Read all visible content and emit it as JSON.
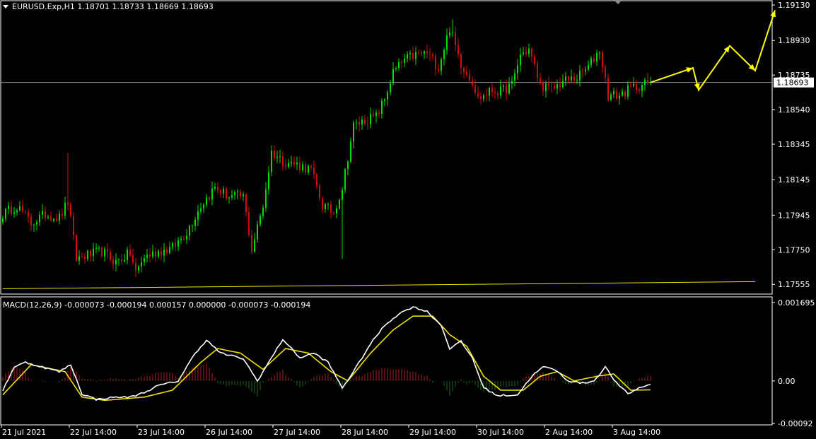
{
  "header": {
    "symbol": "EURUSD.Exp,H1",
    "open": "1.18701",
    "high": "1.18733",
    "low": "1.18669",
    "close": "1.18693"
  },
  "macd_header": {
    "name": "MACD(12,26,9)",
    "values": "-0.000073 -0.000194 0.000157 0.000000 -0.000073 -0.000194"
  },
  "colors": {
    "background": "#000000",
    "bull_candle": "#00e000",
    "bear_candle": "#d01010",
    "trendline": "#f0e000",
    "arrow": "#ffff00",
    "macd_main": "#ffffff",
    "macd_signal": "#f0e000",
    "hist_positive": "#b02020",
    "hist_negative": "#1e6a1e",
    "grid_frame": "#ffffff",
    "price_line": "#8c8c8c"
  },
  "chart_data": [
    {
      "type": "candlestick",
      "title": "EURUSD.Exp,H1",
      "current_price": 1.18693,
      "current_price_label": "1.18693",
      "ylim": [
        1.175,
        1.1915
      ],
      "y_tick_labels": [
        "1.19130",
        "1.18930",
        "1.18735",
        "1.18540",
        "1.18345",
        "1.18145",
        "1.17945",
        "1.17750",
        "1.17555"
      ],
      "y_tick_values": [
        1.1913,
        1.1893,
        1.18735,
        1.1854,
        1.18345,
        1.18145,
        1.17945,
        1.1775,
        1.17555
      ],
      "x_tick_labels": [
        "21 Jul 2021",
        "22 Jul 14:00",
        "23 Jul 14:00",
        "26 Jul 14:00",
        "27 Jul 14:00",
        "28 Jul 14:00",
        "29 Jul 14:00",
        "30 Jul 14:00",
        "2 Aug 14:00",
        "3 Aug 14:00"
      ],
      "x_tick_bars": [
        0,
        24,
        48,
        72,
        96,
        120,
        144,
        168,
        192,
        216
      ],
      "bar_count": 230,
      "anchors": [
        [
          0,
          1.1795
        ],
        [
          5,
          1.18
        ],
        [
          10,
          1.179
        ],
        [
          15,
          1.1795
        ],
        [
          20,
          1.1793
        ],
        [
          23,
          1.1802
        ],
        [
          26,
          1.177
        ],
        [
          30,
          1.1772
        ],
        [
          35,
          1.1774
        ],
        [
          40,
          1.1768
        ],
        [
          45,
          1.1773
        ],
        [
          47,
          1.1762
        ],
        [
          50,
          1.1771
        ],
        [
          55,
          1.1774
        ],
        [
          60,
          1.1776
        ],
        [
          65,
          1.1785
        ],
        [
          70,
          1.18
        ],
        [
          75,
          1.181
        ],
        [
          80,
          1.1805
        ],
        [
          85,
          1.1805
        ],
        [
          88,
          1.1775
        ],
        [
          92,
          1.18
        ],
        [
          95,
          1.183
        ],
        [
          99,
          1.1825
        ],
        [
          104,
          1.1823
        ],
        [
          109,
          1.182
        ],
        [
          113,
          1.18
        ],
        [
          117,
          1.1796
        ],
        [
          120,
          1.181
        ],
        [
          124,
          1.1845
        ],
        [
          128,
          1.1848
        ],
        [
          132,
          1.185
        ],
        [
          135,
          1.186
        ],
        [
          138,
          1.1875
        ],
        [
          142,
          1.1882
        ],
        [
          146,
          1.1885
        ],
        [
          150,
          1.1886
        ],
        [
          154,
          1.1878
        ],
        [
          158,
          1.19
        ],
        [
          162,
          1.188
        ],
        [
          166,
          1.187
        ],
        [
          168,
          1.186
        ],
        [
          170,
          1.1862
        ],
        [
          173,
          1.1865
        ],
        [
          176,
          1.1864
        ],
        [
          180,
          1.1868
        ],
        [
          183,
          1.1885
        ],
        [
          186,
          1.1888
        ],
        [
          190,
          1.1868
        ],
        [
          194,
          1.1865
        ],
        [
          198,
          1.187
        ],
        [
          203,
          1.1872
        ],
        [
          207,
          1.1878
        ],
        [
          211,
          1.1888
        ],
        [
          214,
          1.1862
        ],
        [
          218,
          1.1862
        ],
        [
          222,
          1.1866
        ],
        [
          226,
          1.1868
        ],
        [
          229,
          1.18693
        ]
      ],
      "spikes": [
        {
          "bar": 23,
          "high": 1.183
        },
        {
          "bar": 120,
          "low": 1.177
        },
        {
          "bar": 159,
          "high": 1.1905
        }
      ],
      "trendline": {
        "start": [
          0,
          1.1753
        ],
        "end": [
          266,
          1.1757
        ]
      },
      "forecast_path": [
        [
          229,
          1.18693
        ],
        [
          244,
          1.18775
        ],
        [
          246,
          1.1865
        ],
        [
          257,
          1.189
        ],
        [
          266,
          1.1876
        ],
        [
          273,
          1.191
        ]
      ],
      "forecast_arrowheads": [
        1,
        2,
        3,
        4,
        5
      ]
    },
    {
      "type": "macd",
      "title": "MACD(12,26,9)",
      "ylim": [
        -0.00095,
        0.0018
      ],
      "y_tick_labels": [
        "0.001695",
        "0.00",
        "-0.00092"
      ],
      "y_tick_values": [
        0.001695,
        0.0,
        -0.00092
      ],
      "main_anchors": [
        [
          0,
          -0.0002
        ],
        [
          4,
          0.0003
        ],
        [
          8,
          0.0004
        ],
        [
          14,
          0.0003
        ],
        [
          20,
          0.0002
        ],
        [
          24,
          0.00035
        ],
        [
          28,
          -0.00028
        ],
        [
          33,
          -0.0004
        ],
        [
          40,
          -0.00035
        ],
        [
          45,
          -0.00035
        ],
        [
          50,
          -0.00025
        ],
        [
          55,
          -0.0001
        ],
        [
          62,
          0.0
        ],
        [
          68,
          0.0006
        ],
        [
          72,
          0.00088
        ],
        [
          77,
          0.0006
        ],
        [
          85,
          0.00048
        ],
        [
          90,
          0.0
        ],
        [
          95,
          0.0005
        ],
        [
          99,
          0.0009
        ],
        [
          105,
          0.0005
        ],
        [
          110,
          0.0006
        ],
        [
          115,
          0.0004
        ],
        [
          120,
          -0.00015
        ],
        [
          124,
          0.0002
        ],
        [
          130,
          0.0008
        ],
        [
          135,
          0.0012
        ],
        [
          140,
          0.00145
        ],
        [
          145,
          0.0016
        ],
        [
          150,
          0.0015
        ],
        [
          155,
          0.0012
        ],
        [
          158,
          0.0007
        ],
        [
          162,
          0.00085
        ],
        [
          166,
          0.0005
        ],
        [
          170,
          -0.00015
        ],
        [
          175,
          -0.00032
        ],
        [
          182,
          -0.0003
        ],
        [
          187,
          0.0001
        ],
        [
          191,
          0.0003
        ],
        [
          195,
          0.00025
        ],
        [
          200,
          0.0
        ],
        [
          205,
          -5e-05
        ],
        [
          209,
          0.0
        ],
        [
          213,
          0.0003
        ],
        [
          217,
          -5e-05
        ],
        [
          221,
          -0.00028
        ],
        [
          225,
          -0.00015
        ],
        [
          229,
          -7.3e-05
        ]
      ],
      "signal_anchors": [
        [
          0,
          -0.0003
        ],
        [
          10,
          0.00035
        ],
        [
          22,
          0.0002
        ],
        [
          28,
          -0.00035
        ],
        [
          36,
          -0.00042
        ],
        [
          50,
          -0.00035
        ],
        [
          60,
          -0.0002
        ],
        [
          70,
          0.0004
        ],
        [
          76,
          0.0007
        ],
        [
          84,
          0.0006
        ],
        [
          92,
          0.00025
        ],
        [
          100,
          0.0007
        ],
        [
          108,
          0.0006
        ],
        [
          116,
          0.0002
        ],
        [
          122,
          0.0
        ],
        [
          130,
          0.0006
        ],
        [
          138,
          0.0011
        ],
        [
          145,
          0.0014
        ],
        [
          152,
          0.0014
        ],
        [
          158,
          0.001
        ],
        [
          164,
          0.00075
        ],
        [
          170,
          0.0001
        ],
        [
          176,
          -0.0002
        ],
        [
          184,
          -0.0002
        ],
        [
          190,
          0.0001
        ],
        [
          196,
          0.0002
        ],
        [
          202,
          0.0
        ],
        [
          210,
          0.0001
        ],
        [
          216,
          0.00015
        ],
        [
          222,
          -0.0002
        ],
        [
          229,
          -0.000194
        ]
      ]
    }
  ]
}
